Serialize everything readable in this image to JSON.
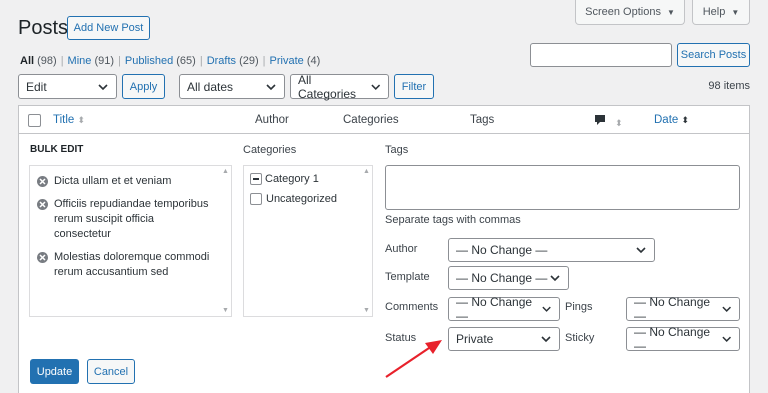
{
  "header": {
    "title": "Posts",
    "add_new": "Add New Post",
    "screen_options": "Screen Options",
    "help": "Help"
  },
  "filters": {
    "all": "All",
    "all_count": "(98)",
    "mine": "Mine",
    "mine_count": "(91)",
    "published": "Published",
    "published_count": "(65)",
    "drafts": "Drafts",
    "drafts_count": "(29)",
    "private": "Private",
    "private_count": "(4)",
    "search_button": "Search Posts",
    "search_value": ""
  },
  "toolbar": {
    "bulk_action": "Edit",
    "apply": "Apply",
    "dates": "All dates",
    "categories": "All Categories",
    "filter": "Filter",
    "items_count": "98 items"
  },
  "columns": {
    "title": "Title",
    "author": "Author",
    "categories": "Categories",
    "tags": "Tags",
    "date": "Date"
  },
  "bulk_edit": {
    "heading": "BULK EDIT",
    "posts": [
      [
        "Dicta ullam et et veniam"
      ],
      [
        "Officiis repudiandae temporibus",
        "rerum suscipit officia consectetur"
      ],
      [
        "Molestias doloremque commodi",
        "rerum accusantium sed"
      ]
    ],
    "categories_label": "Categories",
    "categories": [
      "Category 1",
      "Uncategorized"
    ],
    "tags_label": "Tags",
    "tags_value": "",
    "tags_help": "Separate tags with commas",
    "author_label": "Author",
    "author_value": "— No Change —",
    "template_label": "Template",
    "template_value": "— No Change —",
    "comments_label": "Comments",
    "comments_value": "— No Change —",
    "pings_label": "Pings",
    "pings_value": "— No Change —",
    "status_label": "Status",
    "status_value": "Private",
    "sticky_label": "Sticky",
    "sticky_value": "— No Change —",
    "update": "Update",
    "cancel": "Cancel"
  },
  "colors": {
    "accent": "#2271b1",
    "annotation_arrow": "#e8212b"
  }
}
